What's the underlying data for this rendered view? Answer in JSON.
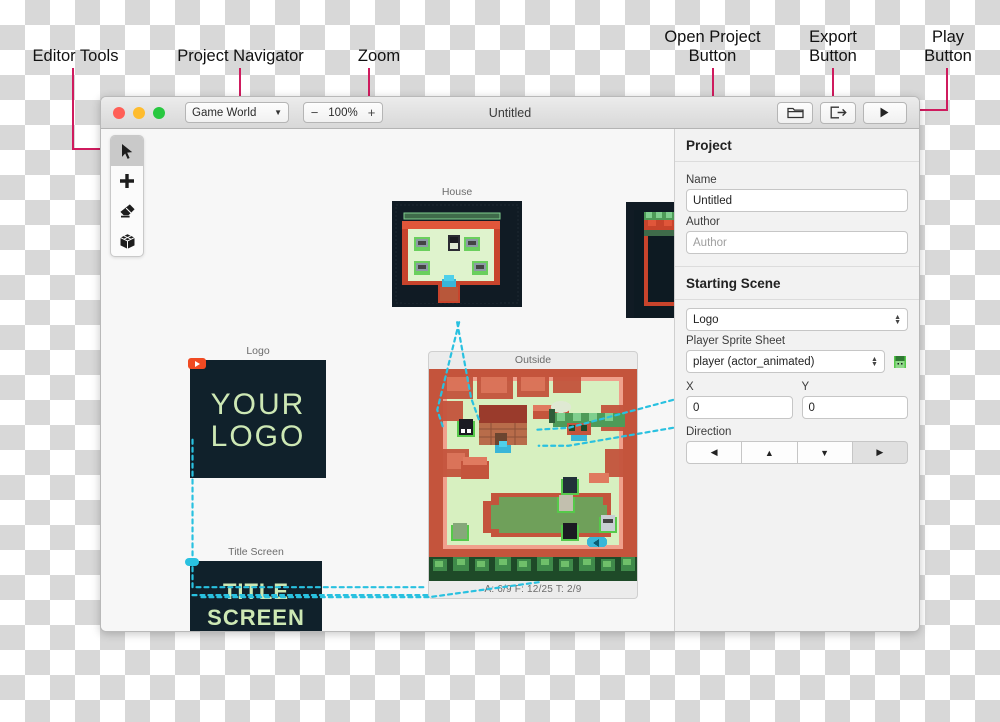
{
  "annotations": [
    {
      "id": "editor-tools",
      "label": "Editor Tools"
    },
    {
      "id": "project-navigator",
      "label": "Project Navigator"
    },
    {
      "id": "zoom",
      "label": "Zoom"
    },
    {
      "id": "open-project",
      "label": "Open Project\nButton"
    },
    {
      "id": "export",
      "label": "Export\nButton"
    },
    {
      "id": "play",
      "label": "Play\nButton"
    }
  ],
  "window": {
    "title": "Untitled",
    "traffic_lights": [
      "close",
      "minimize",
      "maximize"
    ],
    "navigator": {
      "value": "Game World",
      "caret_icon": "chevron-down-icon"
    },
    "zoom": {
      "minus_label": "−",
      "value": "100%",
      "plus_label": "+"
    },
    "toolbar_buttons": [
      {
        "id": "open-project",
        "icon": "folder-open-icon",
        "label": "Open Project"
      },
      {
        "id": "export",
        "icon": "export-icon",
        "label": "Export"
      },
      {
        "id": "play",
        "icon": "play-icon",
        "label": "Play"
      }
    ]
  },
  "tools": [
    {
      "id": "select",
      "icon": "cursor-arrow-icon",
      "label": "Select",
      "active": true
    },
    {
      "id": "add",
      "icon": "plus-icon",
      "label": "Add",
      "active": false
    },
    {
      "id": "erase",
      "icon": "eraser-icon",
      "label": "Erase",
      "active": false
    },
    {
      "id": "block",
      "icon": "cube-icon",
      "label": "Block",
      "active": false
    }
  ],
  "scenes": [
    {
      "id": "house",
      "label": "House"
    },
    {
      "id": "clipped",
      "label": ""
    },
    {
      "id": "logo",
      "label": "Logo",
      "text_line1": "YOUR",
      "text_line2": "LOGO",
      "is_start": true
    },
    {
      "id": "outside",
      "label": "Outside",
      "footer": "A: 6/9   F: 12/25   T: 2/9"
    },
    {
      "id": "title-screen",
      "label": "Title Screen",
      "text_line1": "TITLE",
      "text_line2": "SCREEN"
    }
  ],
  "sidebar": {
    "heading": "Project",
    "name_label": "Name",
    "name_value": "Untitled",
    "author_label": "Author",
    "author_placeholder": "Author",
    "starting_scene_heading": "Starting Scene",
    "scene_value": "Logo",
    "sprite_label": "Player Sprite Sheet",
    "sprite_value": "player (actor_animated)",
    "sprite_preview_icon": "player-sprite-icon",
    "x_label": "X",
    "x_value": "0",
    "y_label": "Y",
    "y_value": "0",
    "direction_label": "Direction",
    "directions": [
      {
        "id": "left",
        "glyph": "◀",
        "icon": "arrow-left-icon",
        "active": false
      },
      {
        "id": "up",
        "glyph": "▲",
        "icon": "arrow-up-icon",
        "active": false
      },
      {
        "id": "down",
        "glyph": "▼",
        "icon": "arrow-down-icon",
        "active": false
      },
      {
        "id": "right",
        "glyph": "▶",
        "icon": "arrow-right-icon",
        "active": true
      }
    ]
  },
  "colors": {
    "annotation": "#cf1b5e",
    "connector": "#29c1e0",
    "start_badge": "#f04a22",
    "grass": "#d7f0c0",
    "wall": "#d9543a",
    "dark": "#0d1b25"
  }
}
